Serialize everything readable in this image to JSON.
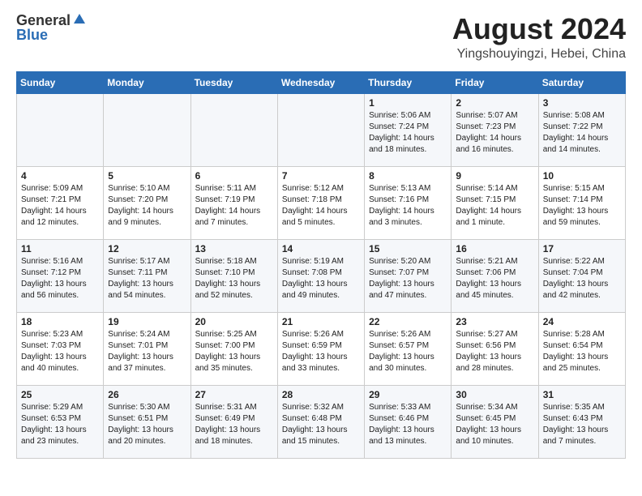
{
  "logo": {
    "general": "General",
    "blue": "Blue"
  },
  "title": "August 2024",
  "location": "Yingshouyingzi, Hebei, China",
  "days_of_week": [
    "Sunday",
    "Monday",
    "Tuesday",
    "Wednesday",
    "Thursday",
    "Friday",
    "Saturday"
  ],
  "weeks": [
    [
      {
        "day": "",
        "info": ""
      },
      {
        "day": "",
        "info": ""
      },
      {
        "day": "",
        "info": ""
      },
      {
        "day": "",
        "info": ""
      },
      {
        "day": "1",
        "info": "Sunrise: 5:06 AM\nSunset: 7:24 PM\nDaylight: 14 hours\nand 18 minutes."
      },
      {
        "day": "2",
        "info": "Sunrise: 5:07 AM\nSunset: 7:23 PM\nDaylight: 14 hours\nand 16 minutes."
      },
      {
        "day": "3",
        "info": "Sunrise: 5:08 AM\nSunset: 7:22 PM\nDaylight: 14 hours\nand 14 minutes."
      }
    ],
    [
      {
        "day": "4",
        "info": "Sunrise: 5:09 AM\nSunset: 7:21 PM\nDaylight: 14 hours\nand 12 minutes."
      },
      {
        "day": "5",
        "info": "Sunrise: 5:10 AM\nSunset: 7:20 PM\nDaylight: 14 hours\nand 9 minutes."
      },
      {
        "day": "6",
        "info": "Sunrise: 5:11 AM\nSunset: 7:19 PM\nDaylight: 14 hours\nand 7 minutes."
      },
      {
        "day": "7",
        "info": "Sunrise: 5:12 AM\nSunset: 7:18 PM\nDaylight: 14 hours\nand 5 minutes."
      },
      {
        "day": "8",
        "info": "Sunrise: 5:13 AM\nSunset: 7:16 PM\nDaylight: 14 hours\nand 3 minutes."
      },
      {
        "day": "9",
        "info": "Sunrise: 5:14 AM\nSunset: 7:15 PM\nDaylight: 14 hours\nand 1 minute."
      },
      {
        "day": "10",
        "info": "Sunrise: 5:15 AM\nSunset: 7:14 PM\nDaylight: 13 hours\nand 59 minutes."
      }
    ],
    [
      {
        "day": "11",
        "info": "Sunrise: 5:16 AM\nSunset: 7:12 PM\nDaylight: 13 hours\nand 56 minutes."
      },
      {
        "day": "12",
        "info": "Sunrise: 5:17 AM\nSunset: 7:11 PM\nDaylight: 13 hours\nand 54 minutes."
      },
      {
        "day": "13",
        "info": "Sunrise: 5:18 AM\nSunset: 7:10 PM\nDaylight: 13 hours\nand 52 minutes."
      },
      {
        "day": "14",
        "info": "Sunrise: 5:19 AM\nSunset: 7:08 PM\nDaylight: 13 hours\nand 49 minutes."
      },
      {
        "day": "15",
        "info": "Sunrise: 5:20 AM\nSunset: 7:07 PM\nDaylight: 13 hours\nand 47 minutes."
      },
      {
        "day": "16",
        "info": "Sunrise: 5:21 AM\nSunset: 7:06 PM\nDaylight: 13 hours\nand 45 minutes."
      },
      {
        "day": "17",
        "info": "Sunrise: 5:22 AM\nSunset: 7:04 PM\nDaylight: 13 hours\nand 42 minutes."
      }
    ],
    [
      {
        "day": "18",
        "info": "Sunrise: 5:23 AM\nSunset: 7:03 PM\nDaylight: 13 hours\nand 40 minutes."
      },
      {
        "day": "19",
        "info": "Sunrise: 5:24 AM\nSunset: 7:01 PM\nDaylight: 13 hours\nand 37 minutes."
      },
      {
        "day": "20",
        "info": "Sunrise: 5:25 AM\nSunset: 7:00 PM\nDaylight: 13 hours\nand 35 minutes."
      },
      {
        "day": "21",
        "info": "Sunrise: 5:26 AM\nSunset: 6:59 PM\nDaylight: 13 hours\nand 33 minutes."
      },
      {
        "day": "22",
        "info": "Sunrise: 5:26 AM\nSunset: 6:57 PM\nDaylight: 13 hours\nand 30 minutes."
      },
      {
        "day": "23",
        "info": "Sunrise: 5:27 AM\nSunset: 6:56 PM\nDaylight: 13 hours\nand 28 minutes."
      },
      {
        "day": "24",
        "info": "Sunrise: 5:28 AM\nSunset: 6:54 PM\nDaylight: 13 hours\nand 25 minutes."
      }
    ],
    [
      {
        "day": "25",
        "info": "Sunrise: 5:29 AM\nSunset: 6:53 PM\nDaylight: 13 hours\nand 23 minutes."
      },
      {
        "day": "26",
        "info": "Sunrise: 5:30 AM\nSunset: 6:51 PM\nDaylight: 13 hours\nand 20 minutes."
      },
      {
        "day": "27",
        "info": "Sunrise: 5:31 AM\nSunset: 6:49 PM\nDaylight: 13 hours\nand 18 minutes."
      },
      {
        "day": "28",
        "info": "Sunrise: 5:32 AM\nSunset: 6:48 PM\nDaylight: 13 hours\nand 15 minutes."
      },
      {
        "day": "29",
        "info": "Sunrise: 5:33 AM\nSunset: 6:46 PM\nDaylight: 13 hours\nand 13 minutes."
      },
      {
        "day": "30",
        "info": "Sunrise: 5:34 AM\nSunset: 6:45 PM\nDaylight: 13 hours\nand 10 minutes."
      },
      {
        "day": "31",
        "info": "Sunrise: 5:35 AM\nSunset: 6:43 PM\nDaylight: 13 hours\nand 7 minutes."
      }
    ]
  ]
}
